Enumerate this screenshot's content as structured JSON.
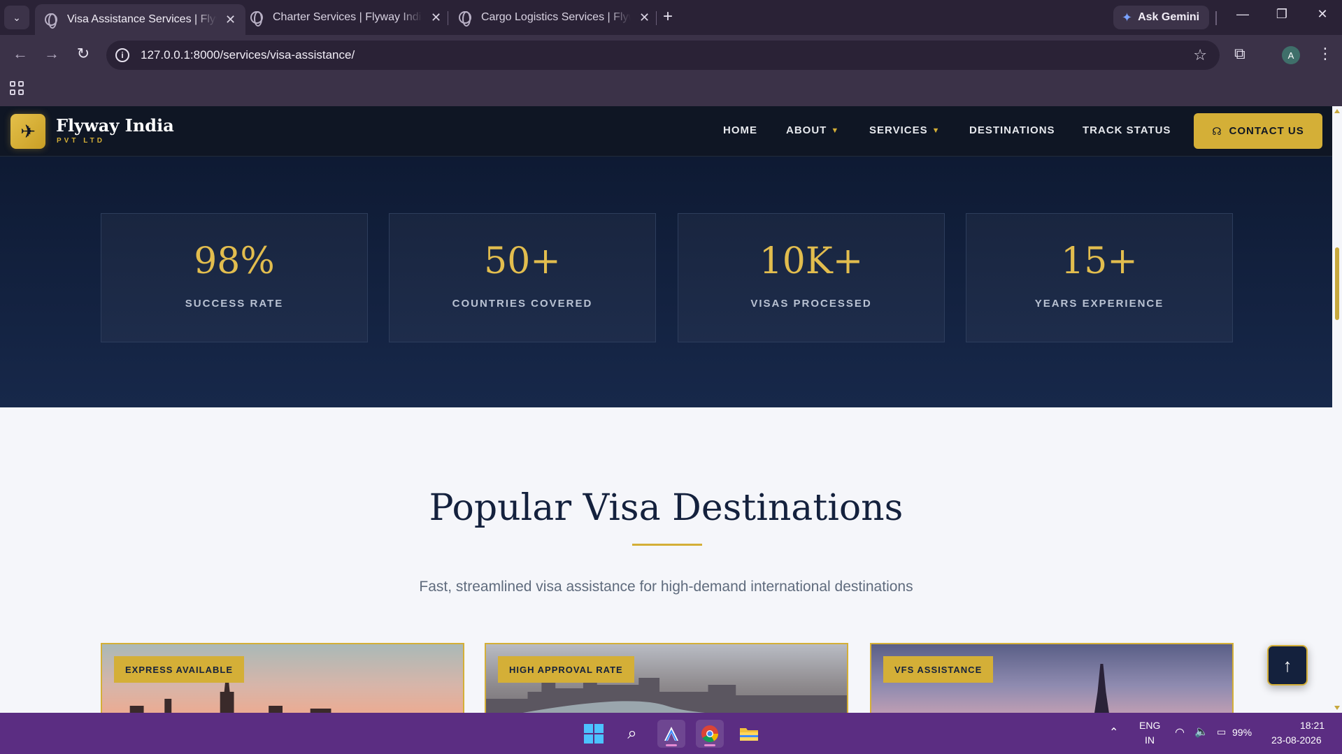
{
  "browser": {
    "tabs": [
      {
        "title": "Visa Assistance Services | Flyway India Pvt Ltd",
        "active": true
      },
      {
        "title": "Charter Services | Flyway India Pvt Ltd",
        "active": false
      },
      {
        "title": "Cargo Logistics Services | Flyway India",
        "active": false
      }
    ],
    "ask_gemini": "Ask Gemini",
    "url": "127.0.0.1:8000/services/visa-assistance/",
    "profile_initial": "A"
  },
  "site": {
    "brand_name": "Flyway India",
    "brand_sub": "PVT LTD",
    "nav": {
      "home": "HOME",
      "about": "ABOUT",
      "services": "SERVICES",
      "destinations": "DESTINATIONS",
      "track": "TRACK STATUS",
      "contact": "CONTACT US"
    },
    "stats": [
      {
        "value": "98%",
        "label": "SUCCESS RATE"
      },
      {
        "value": "50+",
        "label": "COUNTRIES COVERED"
      },
      {
        "value": "10K+",
        "label": "VISAS PROCESSED"
      },
      {
        "value": "15+",
        "label": "YEARS EXPERIENCE"
      }
    ],
    "destinations": {
      "title": "Popular Visa Destinations",
      "subtitle": "Fast, streamlined visa assistance for high-demand international destinations",
      "cards": [
        {
          "badge": "EXPRESS AVAILABLE"
        },
        {
          "badge": "HIGH APPROVAL RATE"
        },
        {
          "badge": "VFS ASSISTANCE"
        }
      ]
    }
  },
  "taskbar": {
    "lang_top": "ENG",
    "lang_bottom": "IN",
    "battery": "99%",
    "time": "18:21",
    "date": "23-08-2026"
  },
  "colors": {
    "accent_gold": "#d4af37",
    "navy": "#14213d",
    "taskbar": "#5b2d82"
  }
}
